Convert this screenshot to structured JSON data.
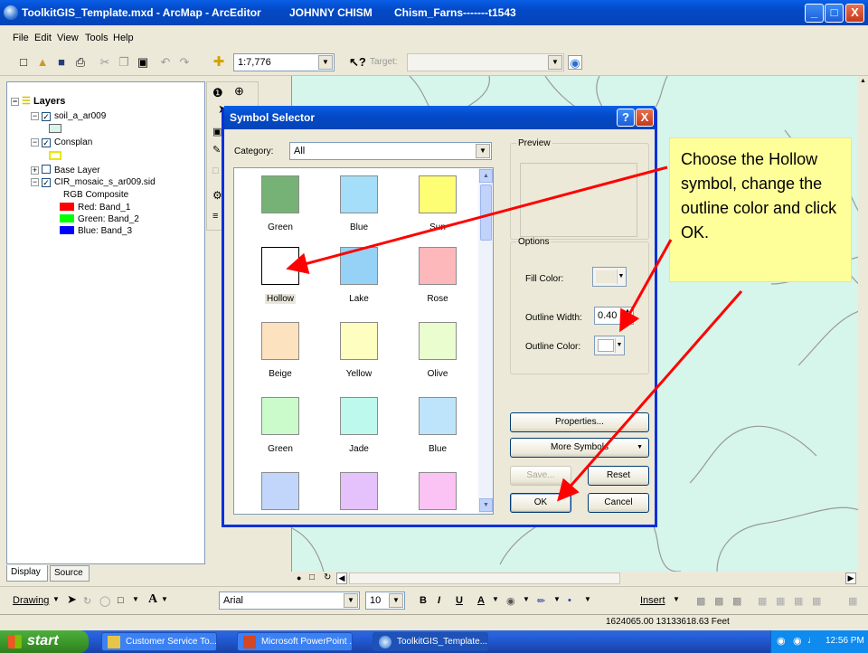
{
  "window": {
    "title": "ToolkitGIS_Template.mxd - ArcMap - ArcEditor",
    "user": "JOHNNY CHISM",
    "project": "Chism_Farns-------t1543",
    "min": "_",
    "max": "□",
    "close": "X"
  },
  "menu": [
    "File",
    "Edit",
    "View",
    "Tools",
    "Help"
  ],
  "toolbar": {
    "scale": "1:7,776",
    "target_label": "Target:"
  },
  "toc": {
    "root": "Layers",
    "layers": [
      {
        "name": "soil_a_ar009",
        "checked": true
      },
      {
        "name": "Consplan",
        "checked": true
      },
      {
        "name": "Base Layer",
        "checked": false
      },
      {
        "name": "CIR_mosaic_s_ar009.sid",
        "checked": true
      }
    ],
    "rgb_title": "RGB Composite",
    "bands": [
      {
        "label": "Red:   Band_1",
        "color": "#ff0000"
      },
      {
        "label": "Green: Band_2",
        "color": "#00ff00"
      },
      {
        "label": "Blue:  Band_3",
        "color": "#0000ff"
      }
    ],
    "tabs": [
      "Display",
      "Source"
    ]
  },
  "dialog": {
    "title": "Symbol Selector",
    "help": "?",
    "close": "X",
    "category_label": "Category:",
    "category_value": "All",
    "preview_label": "Preview",
    "options_label": "Options",
    "fill_color_label": "Fill Color:",
    "outline_width_label": "Outline Width:",
    "outline_width_value": "0.40",
    "outline_color_label": "Outline Color:",
    "symbols": [
      {
        "name": "Green",
        "color": "#76b276"
      },
      {
        "name": "Blue",
        "color": "#a5def8"
      },
      {
        "name": "Sun",
        "color": "#fefe75"
      },
      {
        "name": "Hollow",
        "color": "#ffffff"
      },
      {
        "name": "Lake",
        "color": "#96d2f5"
      },
      {
        "name": "Rose",
        "color": "#fdb8bc"
      },
      {
        "name": "Beige",
        "color": "#fde2bf"
      },
      {
        "name": "Yellow",
        "color": "#fefec0"
      },
      {
        "name": "Olive",
        "color": "#eafdce"
      },
      {
        "name": "Green",
        "color": "#cbfbcb"
      },
      {
        "name": "Jade",
        "color": "#bef9ee"
      },
      {
        "name": "Blue",
        "color": "#bde4fb"
      },
      {
        "name": "",
        "color": "#c2d6fb"
      },
      {
        "name": "",
        "color": "#e5c2fb"
      },
      {
        "name": "",
        "color": "#fbc2f4"
      }
    ],
    "buttons": {
      "properties": "Properties...",
      "more_symbols": "More Symbols",
      "save": "Save...",
      "reset": "Reset",
      "ok": "OK",
      "cancel": "Cancel"
    }
  },
  "callout": {
    "text": "Choose the Hollow symbol, change the outline color and click OK."
  },
  "drawing_toolbar": {
    "drawing": "Drawing",
    "font": "Arial",
    "size": "10",
    "bold": "B",
    "italic": "I",
    "underline": "U",
    "insert": "Insert"
  },
  "status": {
    "coordinates": "1624065.00  13133618.63 Feet"
  },
  "taskbar": {
    "start": "start",
    "tasks": [
      "Customer Service To...",
      "Microsoft PowerPoint ...",
      "ToolkitGIS_Template...."
    ],
    "clock": "12:56 PM"
  },
  "colors": {
    "map_bg": "#d6f5eb",
    "xp_blue": "#0349c6",
    "callout_bg": "#ffff99",
    "arrow": "#ff0000"
  }
}
